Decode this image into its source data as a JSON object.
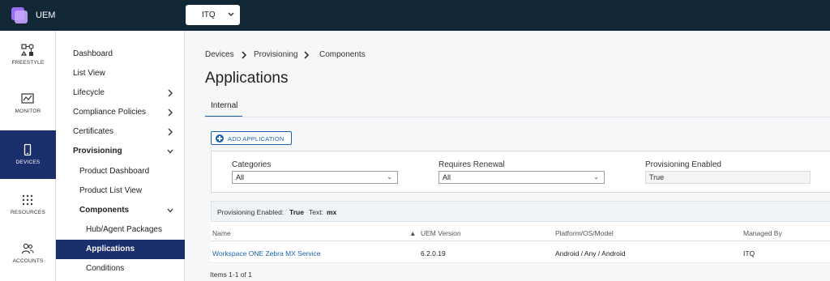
{
  "app": {
    "name": "UEM",
    "org_selector": "ITQ"
  },
  "rail": {
    "items": [
      {
        "label": "FREESTYLE",
        "icon": "freestyle-icon"
      },
      {
        "label": "MONITOR",
        "icon": "monitor-icon"
      },
      {
        "label": "DEVICES",
        "icon": "devices-icon",
        "active": true
      },
      {
        "label": "RESOURCES",
        "icon": "resources-icon"
      },
      {
        "label": "ACCOUNTS",
        "icon": "accounts-icon"
      }
    ]
  },
  "subnav": {
    "items": [
      {
        "label": "Dashboard"
      },
      {
        "label": "List View"
      },
      {
        "label": "Lifecycle",
        "chevron": "right"
      },
      {
        "label": "Compliance Policies",
        "chevron": "right"
      },
      {
        "label": "Certificates",
        "chevron": "right"
      },
      {
        "label": "Provisioning",
        "chevron": "down",
        "expanded": true
      },
      {
        "label": "Product Dashboard"
      },
      {
        "label": "Product List View"
      },
      {
        "label": "Components",
        "chevron": "down",
        "expanded": true
      },
      {
        "label": "Hub/Agent Packages"
      },
      {
        "label": "Applications",
        "selected": true
      },
      {
        "label": "Conditions"
      }
    ]
  },
  "breadcrumb": [
    "Devices",
    "Provisioning",
    "Components"
  ],
  "page_title": "Applications",
  "tabs": [
    {
      "label": "Internal",
      "active": true
    }
  ],
  "add_button": "ADD APPLICATION",
  "filters": {
    "categories": {
      "label": "Categories",
      "value": "All"
    },
    "requires_renewal": {
      "label": "Requires Renewal",
      "value": "All"
    },
    "provisioning_enabled": {
      "label": "Provisioning Enabled",
      "value": "True"
    }
  },
  "filter_summary": {
    "key1": "Provisioning Enabled:",
    "val1": "True",
    "key2": "Text:",
    "val2": "mx"
  },
  "grid": {
    "columns": [
      "Name",
      "UEM Version",
      "Platform/OS/Model",
      "Managed By"
    ],
    "rows": [
      {
        "name": "Workspace ONE Zebra MX Service",
        "version": "6.2.0.19",
        "platform": "Android / Any / Android",
        "managed_by": "ITQ"
      }
    ],
    "count": "Items 1-1 of 1"
  },
  "colors": {
    "topbar": "#122736",
    "active_nav": "#1a2f6b",
    "link": "#1a62b0"
  }
}
